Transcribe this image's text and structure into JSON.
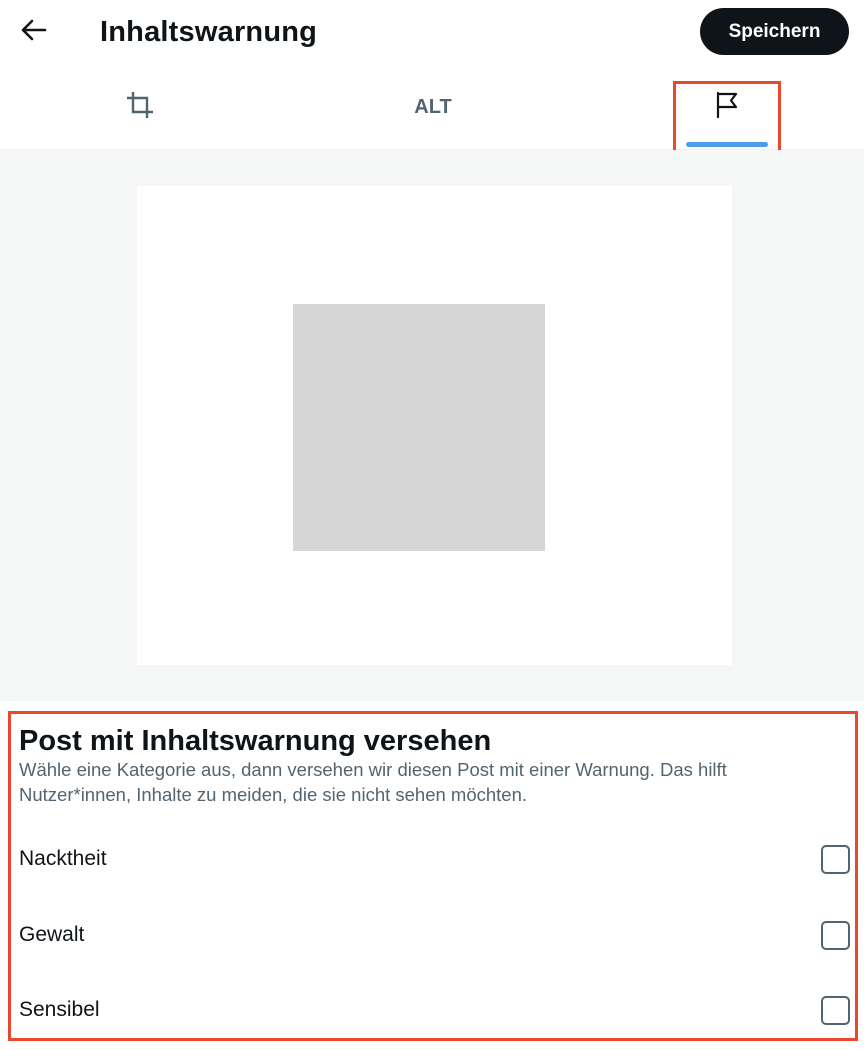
{
  "header": {
    "title": "Inhaltswarnung",
    "save_label": "Speichern"
  },
  "tabs": [
    {
      "id": "crop",
      "icon": "crop-icon"
    },
    {
      "id": "alt",
      "label": "ALT"
    },
    {
      "id": "content-warning",
      "icon": "flag-icon",
      "selected": true
    }
  ],
  "content_warning": {
    "heading": "Post mit Inhaltswarnung versehen",
    "description": "Wähle eine Kategorie aus, dann versehen wir diesen Post mit einer Warnung. Das hilft Nutzer*innen, Inhalte zu meiden, die sie nicht sehen möchten.",
    "options": [
      {
        "label": "Nacktheit",
        "checked": false
      },
      {
        "label": "Gewalt",
        "checked": false
      },
      {
        "label": "Sensibel",
        "checked": false
      }
    ]
  },
  "colors": {
    "accent_blue": "#4c9ee8",
    "highlight_red": "#e8492c",
    "button_dark": "#0f1419",
    "secondary_text": "#536471"
  }
}
